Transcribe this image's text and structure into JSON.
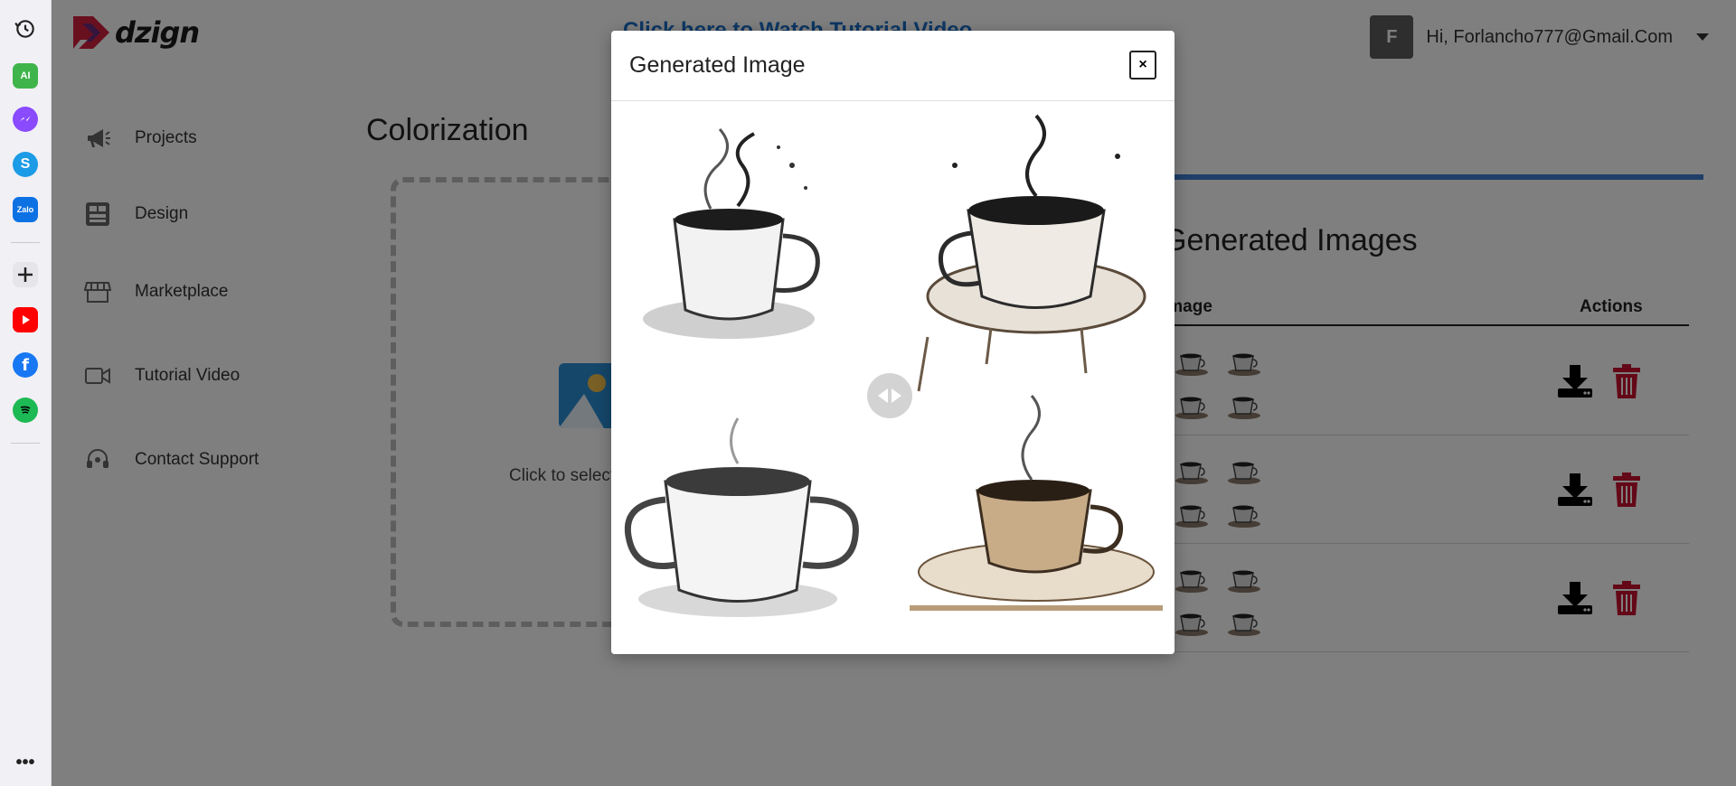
{
  "app": {
    "logo_text": "dzign",
    "tutorial_link": "Click here to Watch Tutorial Video",
    "user": {
      "initial": "F",
      "greeting": "Hi, Forlancho777@Gmail.Com"
    }
  },
  "sidebar": {
    "items": [
      {
        "label": "Projects",
        "icon": "megaphone-icon"
      },
      {
        "label": "Design",
        "icon": "design-icon"
      },
      {
        "label": "Marketplace",
        "icon": "store-icon"
      },
      {
        "label": "Tutorial Video",
        "icon": "video-camera-icon"
      },
      {
        "label": "Contact Support",
        "icon": "headset-icon"
      }
    ]
  },
  "main": {
    "title": "Colorization",
    "upload_text": "Click to select"
  },
  "generated": {
    "title": "Generated Images",
    "columns": [
      "Image",
      "Actions"
    ],
    "rows": [
      {
        "download": "download-icon",
        "delete": "trash-icon"
      },
      {
        "download": "download-icon",
        "delete": "trash-icon"
      },
      {
        "download": "download-icon",
        "delete": "trash-icon"
      }
    ]
  },
  "modal": {
    "title": "Generated Image",
    "close_label": "×"
  },
  "colors": {
    "accent_blue": "#3f7fd3",
    "link_blue": "#1a6fc9",
    "delete_red": "#c8102e",
    "avatar_gray": "#5d5d5d"
  }
}
